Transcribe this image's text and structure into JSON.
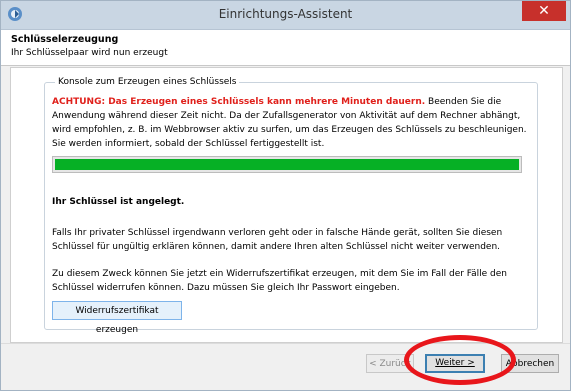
{
  "window": {
    "title": "Einrichtungs-Assistent",
    "close_label": "✕"
  },
  "header": {
    "title": "Schlüsselerzeugung",
    "subtitle": "Ihr Schlüsselpaar wird nun erzeugt"
  },
  "console": {
    "legend": "Konsole zum Erzeugen eines Schlüssels",
    "warning": "ACHTUNG: Das Erzeugen eines Schlüssels kann mehrere Minuten dauern.",
    "info": " Beenden Sie die Anwendung während dieser Zeit nicht. Da der Zufallsgenerator von Aktivität auf dem Rechner abhängt, wird empfohlen, z. B. im Webbrowser aktiv zu surfen, um das Erzeugen des Schlüssels zu beschleunigen. Sie werden informiert, sobald der Schlüssel fertiggestellt ist.",
    "progress_fraction": 1.0,
    "progress_color": "#06b025",
    "done_text": "Ihr Schlüssel ist angelegt.",
    "lost_key_text": "Falls Ihr privater Schlüssel irgendwann verloren geht oder in falsche Hände gerät, sollten Sie diesen Schlüssel für ungültig erklären können, damit andere Ihren alten Schlüssel nicht weiter verwenden.",
    "revoke_text": "Zu diesem Zweck können Sie jetzt ein Widerrufszertifikat erzeugen, mit dem Sie im Fall der Fälle den Schlüssel widerrufen können. Dazu müssen Sie gleich Ihr Passwort eingeben.",
    "revoke_button": "Widerrufszertifikat erzeugen"
  },
  "footer": {
    "back_label": "< Zurück",
    "next_label": "Weiter >",
    "cancel_label": "Abbrechen"
  },
  "colors": {
    "warning": "#e0201b",
    "annotation": "#e8161b"
  }
}
